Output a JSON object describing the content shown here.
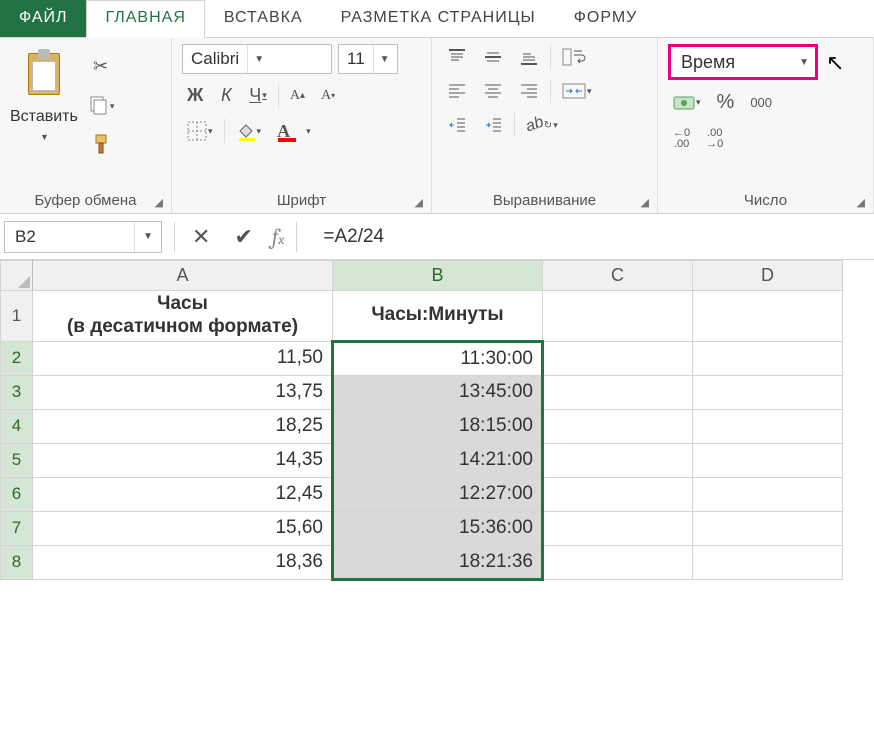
{
  "tabs": {
    "file": "ФАЙЛ",
    "home": "ГЛАВНАЯ",
    "insert": "ВСТАВКА",
    "pagelayout": "РАЗМЕТКА СТРАНИЦЫ",
    "formulas": "ФОРМУ"
  },
  "ribbon": {
    "clipboard": {
      "paste": "Вставить",
      "label": "Буфер обмена"
    },
    "font": {
      "name": "Calibri",
      "size": "11",
      "bold": "Ж",
      "italic": "К",
      "underline": "Ч",
      "label": "Шрифт"
    },
    "alignment": {
      "label": "Выравнивание"
    },
    "number": {
      "format": "Время",
      "percent": "%",
      "thousands": "000",
      "inc_dec1": "←0\n.00",
      "inc_dec2": ".00\n→0",
      "label": "Число"
    }
  },
  "formula_bar": {
    "namebox": "B2",
    "formula": "=A2/24"
  },
  "grid": {
    "cols": [
      "A",
      "B",
      "C",
      "D"
    ],
    "header": {
      "A": "Часы\n(в десатичном формате)",
      "B": "Часы:Минуты"
    },
    "rows": [
      {
        "n": "2",
        "A": "11,50",
        "B": "11:30:00"
      },
      {
        "n": "3",
        "A": "13,75",
        "B": "13:45:00"
      },
      {
        "n": "4",
        "A": "18,25",
        "B": "18:15:00"
      },
      {
        "n": "5",
        "A": "14,35",
        "B": "14:21:00"
      },
      {
        "n": "6",
        "A": "12,45",
        "B": "12:27:00"
      },
      {
        "n": "7",
        "A": "15,60",
        "B": "15:36:00"
      },
      {
        "n": "8",
        "A": "18,36",
        "B": "18:21:36"
      }
    ]
  }
}
